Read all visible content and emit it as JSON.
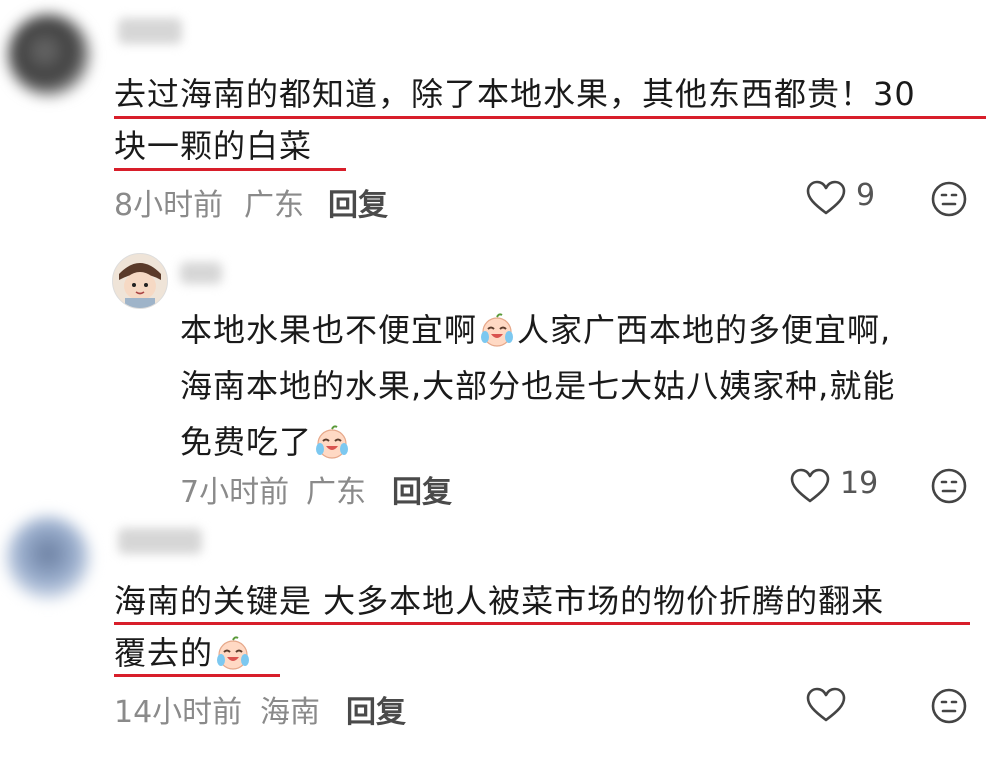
{
  "comments": [
    {
      "text_lines": [
        "去过海南的都知道，除了本地水果，其他东西都贵！30",
        "块一颗的白菜"
      ],
      "time": "8小时前",
      "location": "广东",
      "reply_label": "回复",
      "likes": "9",
      "reply": {
        "line1_a": "本地水果也不便宜啊",
        "line1_b": "人家广西本地的多便宜啊,",
        "line2": "海南本地的水果,大部分也是七大姑八姨家种,就能",
        "line3": "免费吃了",
        "time": "7小时前",
        "location": "广东",
        "reply_label": "回复",
        "likes": "19"
      }
    },
    {
      "text_lines": [
        "海南的关键是 大多本地人被菜市场的物价折腾的翻来",
        "覆去的"
      ],
      "time": "14小时前",
      "location": "海南",
      "reply_label": "回复",
      "likes": ""
    }
  ],
  "icons": {
    "like": "heart-outline-icon",
    "comment": "smiley-face-icon",
    "emoji": "crying-laughing-emoji-icon"
  },
  "colors": {
    "highlight": "#d81e2a",
    "meta": "#8a8a8a"
  }
}
